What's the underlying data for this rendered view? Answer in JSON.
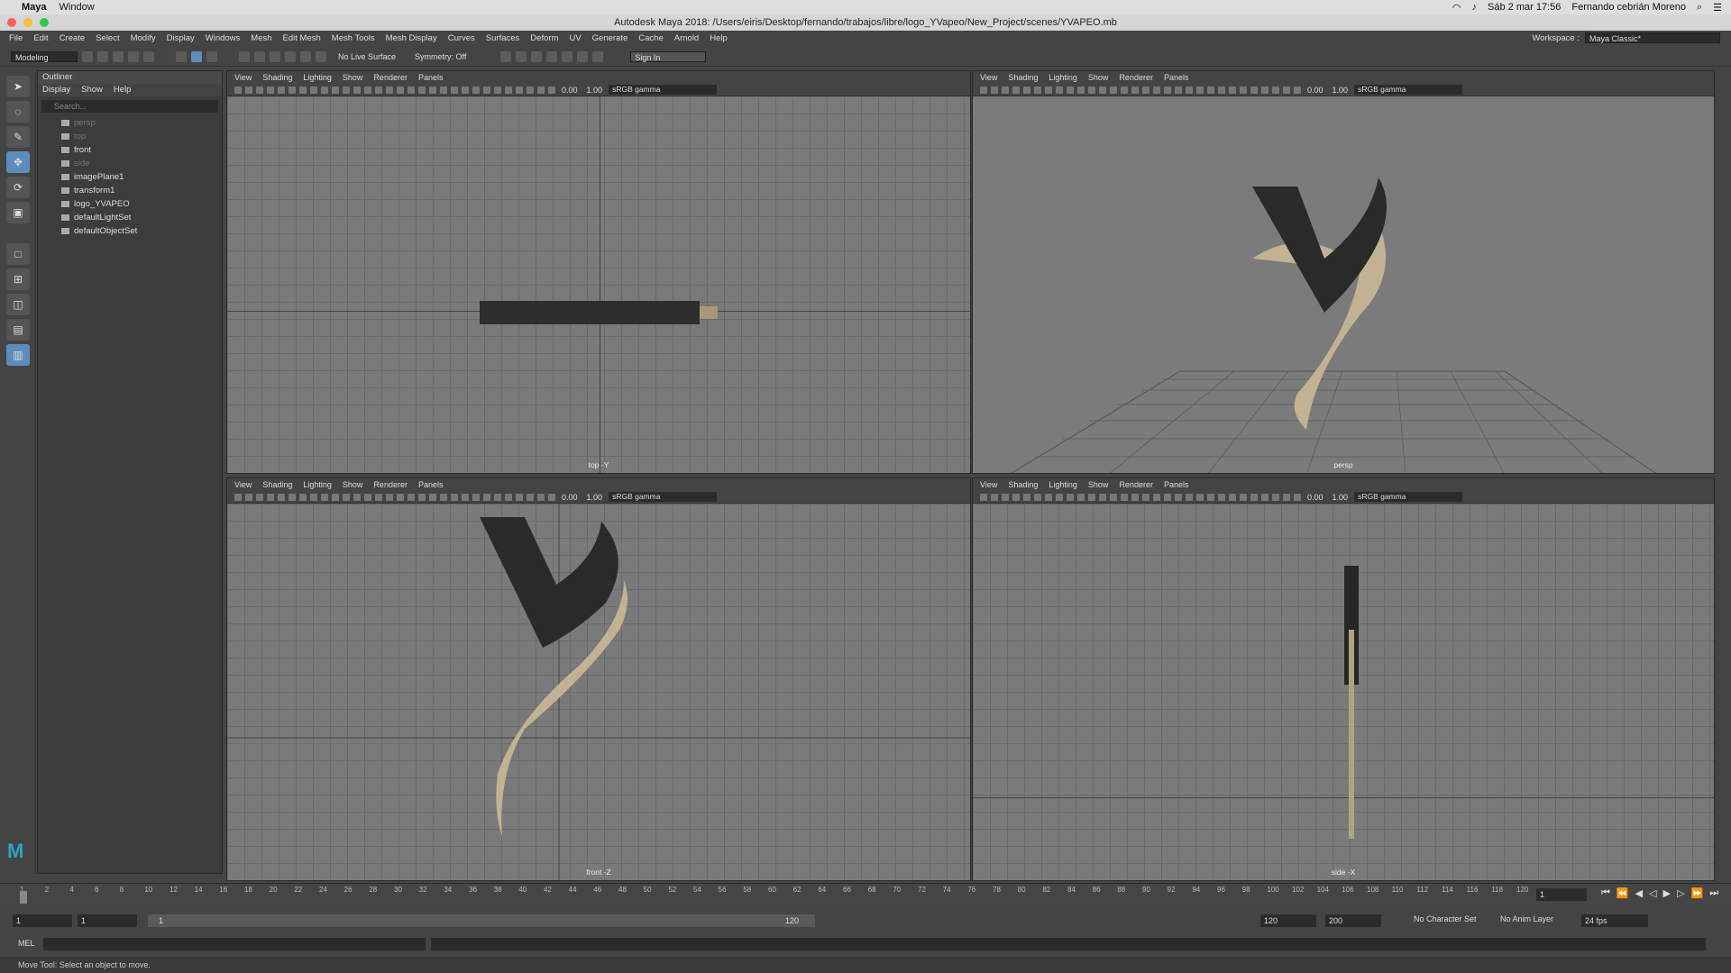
{
  "mac_menu": {
    "app": "Maya",
    "window": "Window",
    "datetime": "Sáb 2 mar 17:56",
    "user": "Fernando cebrián Moreno"
  },
  "window_title": "Autodesk Maya 2018: /Users/eiris/Desktop/fernando/trabajos/libre/logo_YVapeo/New_Project/scenes/YVAPEO.mb",
  "menubar": [
    "File",
    "Edit",
    "Create",
    "Select",
    "Modify",
    "Display",
    "Windows",
    "Mesh",
    "Edit Mesh",
    "Mesh Tools",
    "Mesh Display",
    "Curves",
    "Surfaces",
    "Deform",
    "UV",
    "Generate",
    "Cache",
    "Arnold",
    "Help"
  ],
  "workspace": {
    "label": "Workspace :",
    "value": "Maya Classic*"
  },
  "shelf": {
    "mode": "Modeling",
    "live_surface": "No Live Surface",
    "symmetry": "Symmetry: Off",
    "sign_in": "Sign In"
  },
  "outliner": {
    "title": "Outliner",
    "menu": [
      "Display",
      "Show",
      "Help"
    ],
    "search_placeholder": "Search...",
    "items": [
      {
        "label": "persp",
        "dim": true
      },
      {
        "label": "top",
        "dim": true
      },
      {
        "label": "front",
        "dim": false
      },
      {
        "label": "side",
        "dim": true
      },
      {
        "label": "imagePlane1",
        "dim": false
      },
      {
        "label": "transform1",
        "dim": false
      },
      {
        "label": "logo_YVAPEO",
        "dim": false
      },
      {
        "label": "defaultLightSet",
        "dim": false
      },
      {
        "label": "defaultObjectSet",
        "dim": false
      }
    ]
  },
  "viewport_menu": [
    "View",
    "Shading",
    "Lighting",
    "Show",
    "Renderer",
    "Panels"
  ],
  "viewport_tools": {
    "val1": "0.00",
    "val2": "1.00",
    "gamma": "sRGB gamma"
  },
  "viewports": [
    {
      "label": "top -Y"
    },
    {
      "label": "persp"
    },
    {
      "label": "front -Z"
    },
    {
      "label": "side -X"
    }
  ],
  "timeline": {
    "ticks": [
      "1",
      "2",
      "4",
      "6",
      "8",
      "10",
      "12",
      "14",
      "16",
      "18",
      "20",
      "22",
      "24",
      "26",
      "28",
      "30",
      "32",
      "34",
      "36",
      "38",
      "40",
      "42",
      "44",
      "46",
      "48",
      "50",
      "52",
      "54",
      "56",
      "58",
      "60",
      "62",
      "64",
      "66",
      "68",
      "70",
      "72",
      "74",
      "76",
      "78",
      "80",
      "82",
      "84",
      "86",
      "88",
      "90",
      "92",
      "94",
      "96",
      "98",
      "100",
      "102",
      "104",
      "106",
      "108",
      "110",
      "112",
      "114",
      "116",
      "118",
      "120"
    ],
    "current": "1"
  },
  "range": {
    "start": "1",
    "start2": "1",
    "slider_start": "1",
    "slider_end": "120",
    "end": "120",
    "end2": "200",
    "char_set": "No Character Set",
    "anim_layer": "No Anim Layer",
    "fps": "24 fps"
  },
  "command": {
    "lang": "MEL"
  },
  "help_line": "Move Tool: Select an object to move.",
  "colors": {
    "logo_dark": "#2a2a2a",
    "logo_tan": "#c2b294",
    "accent": "#5d8dbd"
  }
}
